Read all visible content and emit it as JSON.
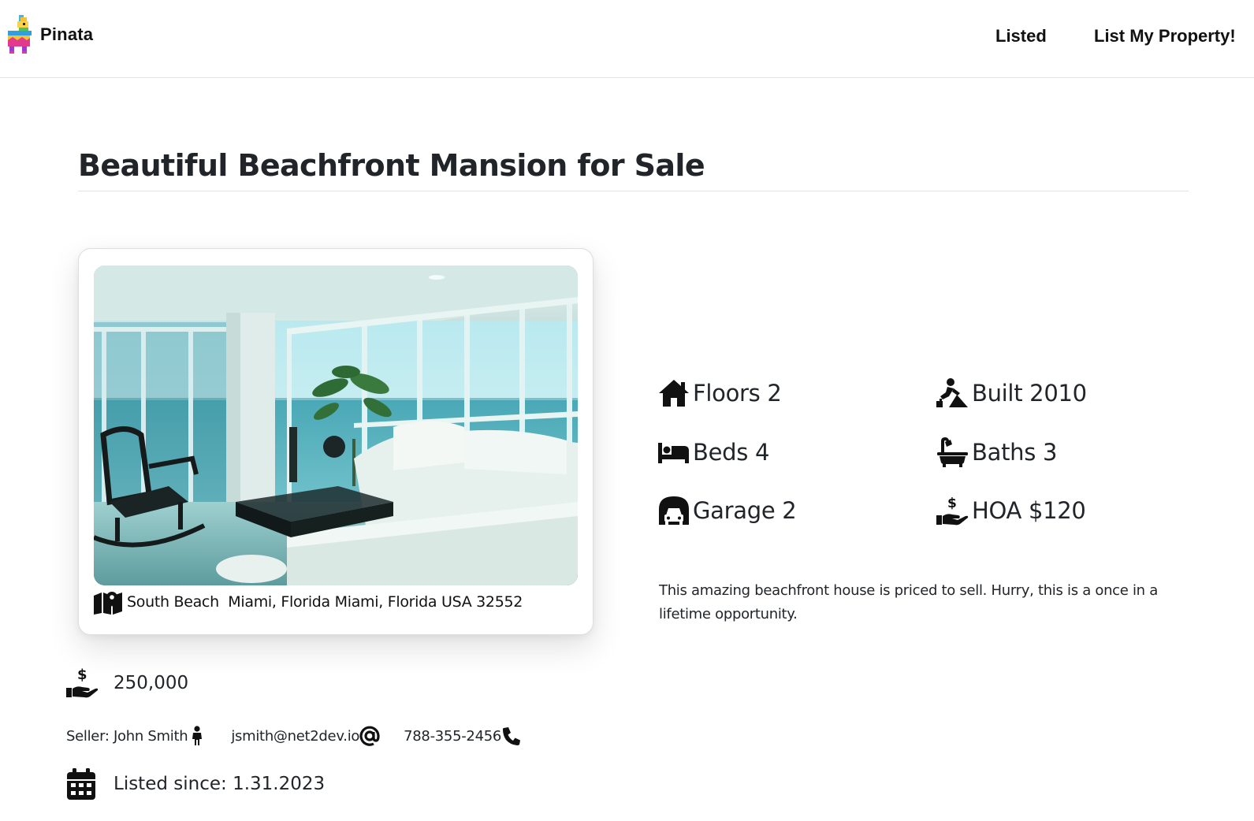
{
  "header": {
    "brand_name": "Pinata",
    "nav": [
      {
        "label": "Listed"
      },
      {
        "label": "List My Property!"
      }
    ]
  },
  "listing": {
    "title": "Beautiful Beachfront Mansion for Sale",
    "address": "South Beach  Miami, Florida Miami, Florida USA 32552",
    "features": {
      "floors": "Floors 2",
      "built": "Built 2010",
      "beds": "Beds 4",
      "baths": "Baths 3",
      "garage": "Garage 2",
      "hoa": "HOA $120"
    },
    "description": "This amazing beachfront house is priced to sell. Hurry, this is a once in a lifetime opportunity.",
    "price": "250,000",
    "seller": {
      "name": "Seller: John Smith",
      "email": "jsmith@net2dev.io",
      "phone": "788-355-2456"
    },
    "listed_since": "Listed since: 1.31.2023"
  },
  "icons": {
    "logo": "pinata-logo",
    "address": "map-icon",
    "floors": "house-icon",
    "built": "worker-icon",
    "beds": "bed-icon",
    "baths": "bath-icon",
    "garage": "garage-icon",
    "hoa": "hand-dollar-icon",
    "price": "hand-dollar-icon",
    "seller": "person-icon",
    "email": "at-icon",
    "phone": "phone-icon",
    "listed": "calendar-icon"
  },
  "colors": {
    "text": "#212529",
    "border": "#dedede",
    "photo_sea": "#5fb8c4",
    "photo_sofa": "#e6f0ec"
  }
}
